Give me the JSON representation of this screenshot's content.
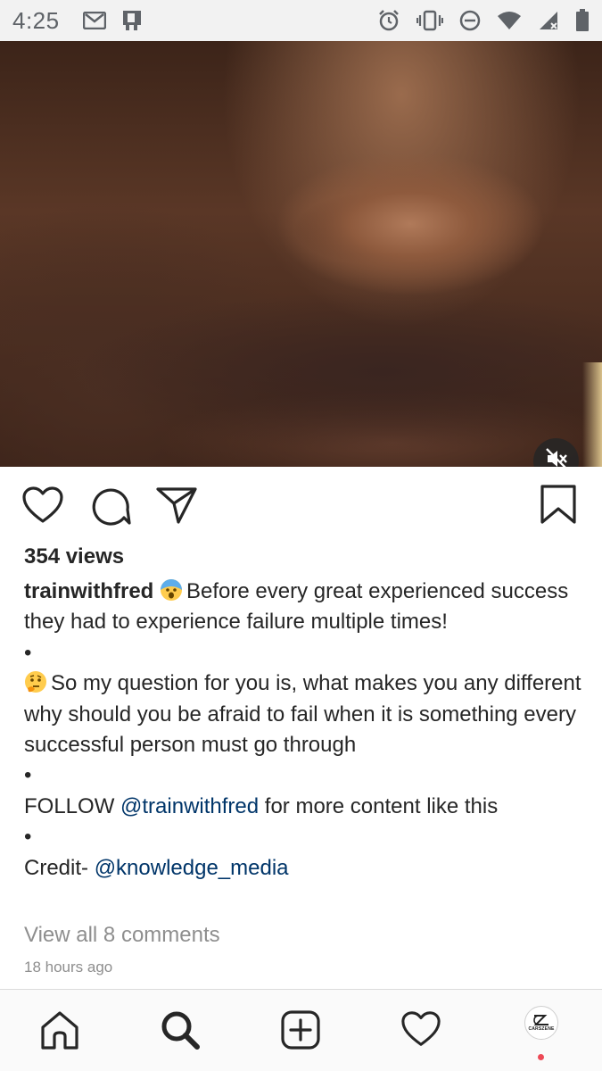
{
  "status_bar": {
    "time": "4:25",
    "left_icons": [
      "gmail-icon",
      "notification-app-icon"
    ],
    "right_icons": [
      "alarm-icon",
      "vibrate-icon",
      "do-not-disturb-icon",
      "wifi-icon",
      "signal-icon",
      "battery-icon"
    ]
  },
  "post": {
    "media_icons": {
      "mute": "volume-off-icon"
    },
    "actions": [
      "heart-icon",
      "comment-icon",
      "share-icon",
      "bookmark-icon"
    ],
    "views": "354 views",
    "username": "trainwithfred",
    "caption": {
      "line1_text": "Before every great experienced success they had to experience failure multiple times!",
      "bullet1": "•",
      "line2_text": "So my question for you is, what makes you any different why should you be afraid to fail when it is something every successful person must go through",
      "bullet2": "•",
      "follow_prefix": "FOLLOW ",
      "follow_mention": "@trainwithfred",
      "follow_suffix": " for more content like this",
      "bullet3": "•",
      "credit_prefix": "Credit- ",
      "credit_mention": "@knowledge_media"
    },
    "view_comments": "View all 8 comments",
    "timestamp": "18 hours ago"
  },
  "bottom_nav": {
    "items": [
      "home-icon",
      "search-icon",
      "add-post-icon",
      "heart-activity-icon",
      "profile-avatar"
    ],
    "profile_logo_text": "CARSZENE"
  },
  "colors": {
    "text": "#262626",
    "mention": "#003569",
    "muted": "#8e8e8e",
    "notification_dot": "#ed4956"
  }
}
